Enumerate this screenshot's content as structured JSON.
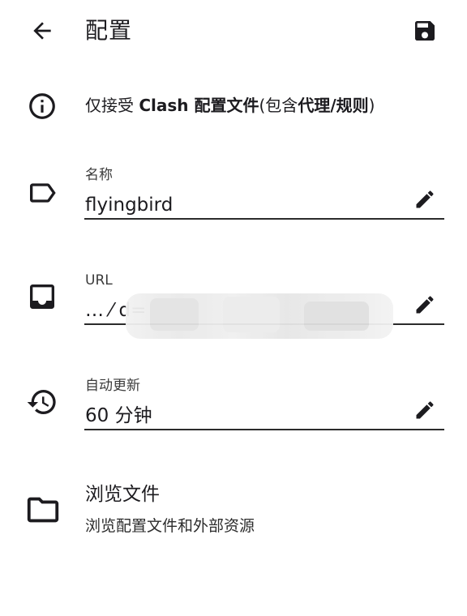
{
  "appbar": {
    "title": "配置",
    "back_icon": "arrow-back-icon",
    "save_icon": "save-icon"
  },
  "info": {
    "icon": "info-icon",
    "text_prefix": "仅接受 ",
    "text_bold1": "Clash 配置文件",
    "text_mid": "(包含",
    "text_bold2": "代理",
    "text_slash": "/",
    "text_bold3": "规则",
    "text_suffix": ")"
  },
  "fields": {
    "name": {
      "label": "名称",
      "value": "flyingbird",
      "icon": "label-icon"
    },
    "url": {
      "label": "URL",
      "value": "…    ⁄                                                    d=",
      "icon": "inbox-icon"
    },
    "update": {
      "label": "自动更新",
      "value": "60 分钟",
      "icon": "history-icon"
    }
  },
  "browse": {
    "title": "浏览文件",
    "subtitle": "浏览配置文件和外部资源",
    "icon": "folder-icon"
  }
}
